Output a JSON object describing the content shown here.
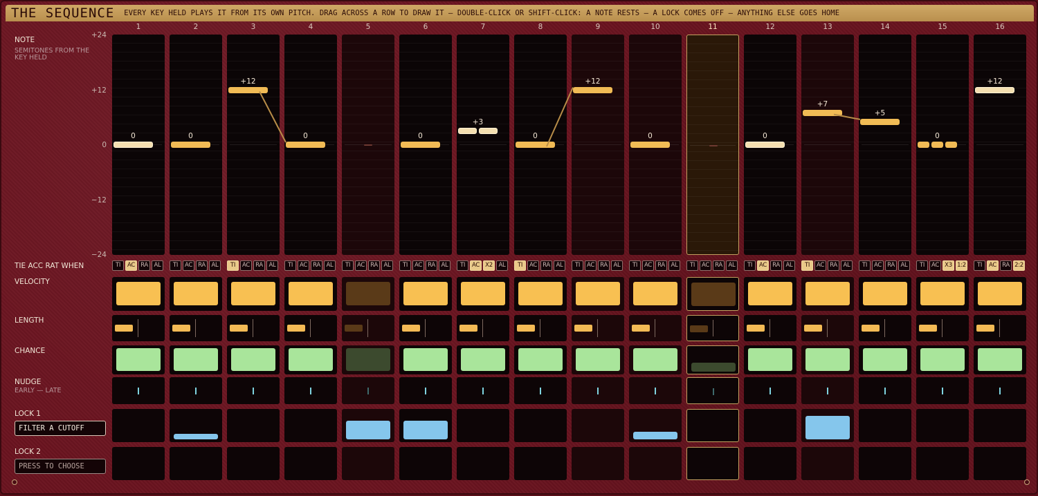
{
  "header": {
    "title": "THE SEQUENCE",
    "hint": "EVERY KEY HELD PLAYS IT FROM ITS OWN PITCH. DRAG ACROSS A ROW TO DRAW IT — DOUBLE-CLICK OR SHIFT-CLICK: A NOTE RESTS — A LOCK COMES OFF — ANYTHING ELSE GOES HOME"
  },
  "rows": {
    "note": "NOTE",
    "note_sub": "SEMITONES FROM THE KEY HELD",
    "flags": "TIE ACC RAT WHEN",
    "velocity": "VELOCITY",
    "length": "LENGTH",
    "chance": "CHANCE",
    "nudge": "NUDGE",
    "nudge_sub": "EARLY — LATE",
    "lock1": "LOCK 1",
    "lock1_value": "FILTER A CUTOFF",
    "lock2": "LOCK 2",
    "lock2_value": "PRESS TO CHOOSE"
  },
  "y_ticks": [
    "+24",
    "+12",
    "0",
    "−12",
    "−24"
  ],
  "colors": {
    "note": "#f1bb55",
    "velocity": "#f8c052",
    "chance": "#a9e59b",
    "lock": "#85c6ec",
    "nudge": "#7fd4e0",
    "frame": "#6b1420"
  },
  "steps": [
    {
      "num": "1",
      "label": "0",
      "semi": 0,
      "flags": [
        "TI",
        "AC",
        "RA",
        "AL"
      ],
      "flags_on": [
        1
      ],
      "vel": 1,
      "len": 0.62,
      "chance": 1,
      "nudge": 0,
      "lock1": null,
      "light": true
    },
    {
      "num": "2",
      "label": "0",
      "semi": 0,
      "flags": [
        "TI",
        "AC",
        "RA",
        "AL"
      ],
      "flags_on": [],
      "vel": 1,
      "len": 0.62,
      "chance": 1,
      "nudge": 0,
      "lock1": 0.2
    },
    {
      "num": "3",
      "label": "+12",
      "semi": 12,
      "flags": [
        "TI",
        "AC",
        "RA",
        "AL"
      ],
      "flags_on": [
        0
      ],
      "vel": 1,
      "len": 0.62,
      "chance": 1,
      "nudge": 0,
      "lock1": null,
      "tie": true
    },
    {
      "num": "4",
      "label": "0",
      "semi": 0,
      "flags": [
        "TI",
        "AC",
        "RA",
        "AL"
      ],
      "flags_on": [],
      "vel": 1,
      "len": 0.62,
      "chance": 1,
      "nudge": 0,
      "lock1": null
    },
    {
      "num": "5",
      "label": "",
      "semi": 0,
      "rest": true,
      "flags": [
        "TI",
        "AC",
        "RA",
        "AL"
      ],
      "flags_on": [],
      "vel": 1,
      "len": 0.62,
      "chance": 1,
      "nudge": 0,
      "lock1": 0.7,
      "dim": true
    },
    {
      "num": "6",
      "label": "0",
      "semi": 0,
      "flags": [
        "TI",
        "AC",
        "RA",
        "AL"
      ],
      "flags_on": [],
      "vel": 1,
      "len": 0.62,
      "chance": 1,
      "nudge": 0,
      "lock1": 0.7
    },
    {
      "num": "7",
      "label": "+3",
      "semi": 3,
      "ratchet": 2,
      "flags": [
        "TI",
        "AC",
        "X2",
        "AL"
      ],
      "flags_on": [
        1,
        2
      ],
      "vel": 1,
      "len": 0.62,
      "chance": 1,
      "nudge": 0,
      "lock1": null,
      "light": true
    },
    {
      "num": "8",
      "label": "0",
      "semi": 0,
      "flags": [
        "TI",
        "AC",
        "RA",
        "AL"
      ],
      "flags_on": [
        0
      ],
      "vel": 1,
      "len": 0.62,
      "chance": 1,
      "nudge": 0,
      "lock1": null,
      "tie": true
    },
    {
      "num": "9",
      "label": "+12",
      "semi": 12,
      "flags": [
        "TI",
        "AC",
        "RA",
        "AL"
      ],
      "flags_on": [],
      "vel": 1,
      "len": 0.62,
      "chance": 1,
      "nudge": 0,
      "lock1": null,
      "dim": true
    },
    {
      "num": "10",
      "label": "0",
      "semi": 0,
      "flags": [
        "TI",
        "AC",
        "RA",
        "AL"
      ],
      "flags_on": [],
      "vel": 1,
      "len": 0.62,
      "chance": 1,
      "nudge": 0,
      "lock1": 0.3,
      "dim": true
    },
    {
      "num": "11",
      "label": "",
      "semi": 0,
      "rest": true,
      "flags": [
        "TI",
        "AC",
        "RA",
        "AL"
      ],
      "flags_on": [],
      "vel": 1,
      "len": 0.62,
      "chance": 0.4,
      "nudge": 0,
      "lock1": null,
      "current": true
    },
    {
      "num": "12",
      "label": "0",
      "semi": 0,
      "flags": [
        "TI",
        "AC",
        "RA",
        "AL"
      ],
      "flags_on": [
        1
      ],
      "vel": 1,
      "len": 0.62,
      "chance": 1,
      "nudge": 0,
      "lock1": null,
      "light": true
    },
    {
      "num": "13",
      "label": "+7",
      "semi": 7,
      "flags": [
        "TI",
        "AC",
        "RA",
        "AL"
      ],
      "flags_on": [
        0
      ],
      "vel": 1,
      "len": 0.62,
      "chance": 1,
      "nudge": 0,
      "lock1": 0.9,
      "dim": true,
      "tie": true
    },
    {
      "num": "14",
      "label": "+5",
      "semi": 5,
      "flags": [
        "TI",
        "AC",
        "RA",
        "AL"
      ],
      "flags_on": [],
      "vel": 1,
      "len": 0.62,
      "chance": 1,
      "nudge": 0,
      "lock1": null
    },
    {
      "num": "15",
      "label": "0",
      "semi": 0,
      "ratchet": 3,
      "flags": [
        "TI",
        "AC",
        "X3",
        "1:2"
      ],
      "flags_on": [
        2,
        3
      ],
      "vel": 1,
      "len": 0.62,
      "chance": 1,
      "nudge": 0,
      "lock1": null
    },
    {
      "num": "16",
      "label": "+12",
      "semi": 12,
      "flags": [
        "TI",
        "AC",
        "RA",
        "2:2"
      ],
      "flags_on": [
        1,
        3
      ],
      "vel": 1,
      "len": 0.62,
      "chance": 1,
      "nudge": 0,
      "lock1": null,
      "light": true
    }
  ]
}
